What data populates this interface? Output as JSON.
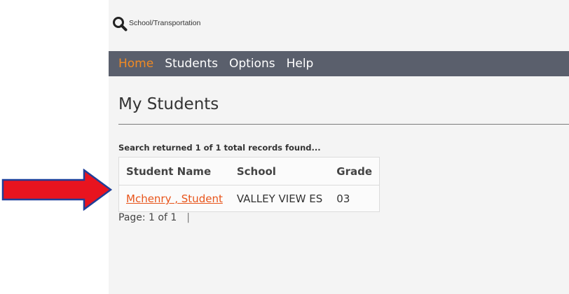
{
  "header": {
    "app_title": "School/Transportation",
    "search_icon": "search-icon"
  },
  "nav": {
    "items": [
      {
        "label": "Home",
        "active": true
      },
      {
        "label": "Students",
        "active": false
      },
      {
        "label": "Options",
        "active": false
      },
      {
        "label": "Help",
        "active": false
      }
    ]
  },
  "main": {
    "page_title": "My Students",
    "search_summary": "Search returned 1 of 1 total records found...",
    "table": {
      "columns": [
        "Student Name",
        "School",
        "Grade"
      ],
      "rows": [
        {
          "student_name": "Mchenry , Student",
          "school": "VALLEY VIEW ES",
          "grade": "03"
        }
      ]
    },
    "pager": {
      "text": "Page: 1 of 1",
      "separator": "|"
    }
  },
  "annotation": {
    "arrow_color": "#e8141f",
    "arrow_outline": "#1f3f99"
  },
  "colors": {
    "nav_bg": "#5a5f6c",
    "nav_active": "#f08a24",
    "link": "#e8541a"
  }
}
